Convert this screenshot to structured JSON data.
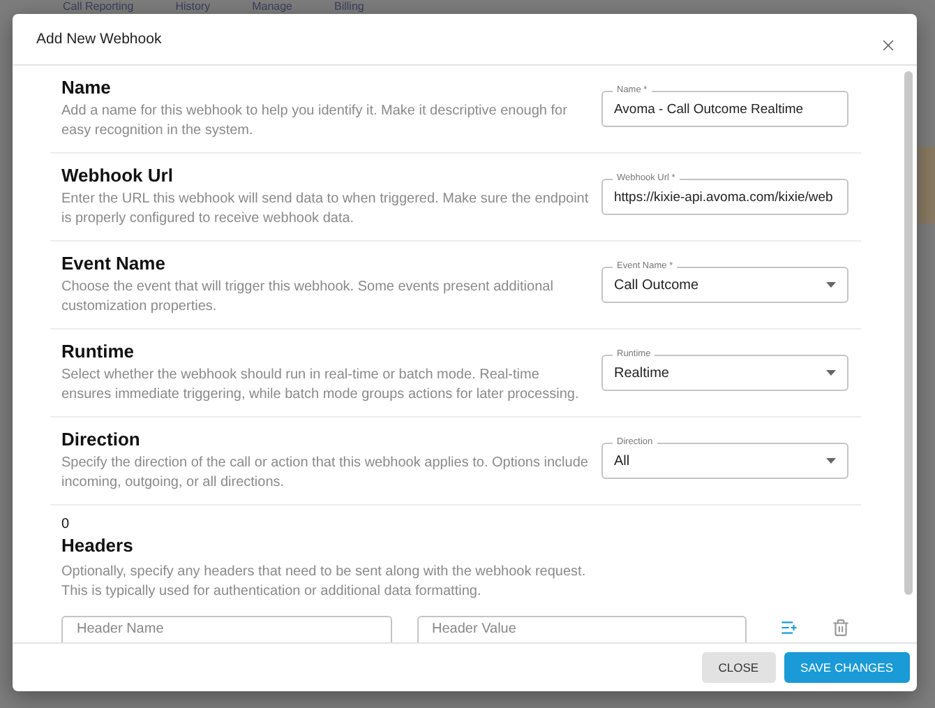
{
  "background_nav": [
    "Call Reporting",
    "History",
    "Manage",
    "Billing"
  ],
  "dialog": {
    "title": "Add New Webhook"
  },
  "sections": [
    {
      "title": "Name",
      "description": "Add a name for this webhook to help you identify it. Make it descriptive enough for easy recognition in the system.",
      "field": {
        "kind": "text",
        "label": "Name *",
        "value": "Avoma - Call Outcome Realtime"
      }
    },
    {
      "title": "Webhook Url",
      "description": "Enter the URL this webhook will send data to when triggered. Make sure the endpoint is properly configured to receive webhook data.",
      "field": {
        "kind": "text",
        "label": "Webhook Url *",
        "value": "https://kixie-api.avoma.com/kixie/web"
      }
    },
    {
      "title": "Event Name",
      "description": "Choose the event that will trigger this webhook. Some events present additional customization properties.",
      "field": {
        "kind": "select",
        "label": "Event Name *",
        "value": "Call Outcome"
      }
    },
    {
      "title": "Runtime",
      "description": "Select whether the webhook should run in real-time or batch mode. Real-time ensures immediate triggering, while batch mode groups actions for later processing.",
      "field": {
        "kind": "select",
        "label": "Runtime",
        "value": "Realtime"
      }
    },
    {
      "title": "Direction",
      "description": "Specify the direction of the call or action that this webhook applies to. Options include incoming, outgoing, or all directions.",
      "field": {
        "kind": "select",
        "label": "Direction",
        "value": "All"
      }
    }
  ],
  "headers": {
    "count": "0",
    "title": "Headers",
    "description_lines": [
      "Optionally, specify any headers that need to be sent along with the webhook request.",
      "This is typically used for authentication or additional data formatting."
    ],
    "fields": [
      {
        "placeholder": "Header Name"
      },
      {
        "placeholder": "Header Value"
      }
    ]
  },
  "footer_buttons": [
    {
      "label": "CLOSE",
      "kind": "secondary"
    },
    {
      "label": "SAVE CHANGES",
      "kind": "primary"
    }
  ]
}
